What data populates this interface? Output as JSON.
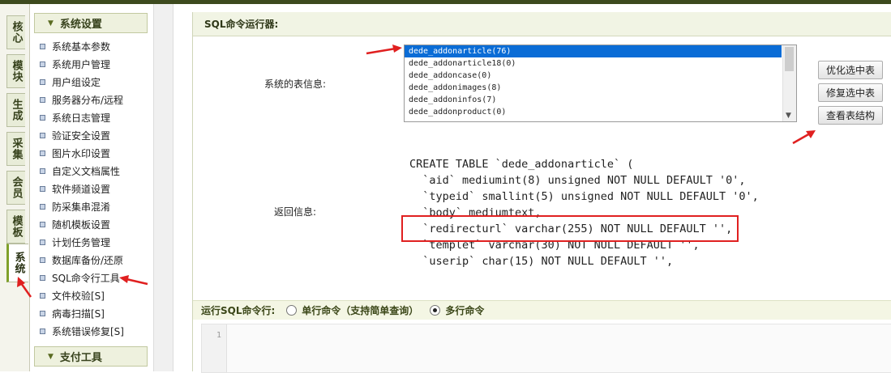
{
  "left_tabs": [
    "核心",
    "模块",
    "生成",
    "采集",
    "会员",
    "模板",
    "系统"
  ],
  "sidebar": {
    "section_title": "系统设置",
    "items": [
      "系统基本参数",
      "系统用户管理",
      "用户组设定",
      "服务器分布/远程",
      "系统日志管理",
      "验证安全设置",
      "图片水印设置",
      "自定义文档属性",
      "软件频道设置",
      "防采集串混淆",
      "随机模板设置",
      "计划任务管理",
      "数据库备份/还原",
      "SQL命令行工具",
      "文件校验[S]",
      "病毒扫描[S]",
      "系统错误修复[S]"
    ],
    "section2_title": "支付工具"
  },
  "panel": {
    "title": "SQL命令运行器:",
    "tables_label": "系统的表信息:",
    "tables": [
      "dede_addonarticle(76)",
      "dede_addonarticle18(0)",
      "dede_addoncase(0)",
      "dede_addonimages(8)",
      "dede_addoninfos(7)",
      "dede_addonproduct(0)"
    ],
    "buttons": {
      "optimize": "优化选中表",
      "repair": "修复选中表",
      "view_structure": "查看表结构"
    },
    "result_label": "返回信息:",
    "result_lines": [
      "CREATE TABLE `dede_addonarticle` (",
      "  `aid` mediumint(8) unsigned NOT NULL DEFAULT '0',",
      "  `typeid` smallint(5) unsigned NOT NULL DEFAULT '0',",
      "  `body` mediumtext,",
      "  `redirecturl` varchar(255) NOT NULL DEFAULT '',",
      "  `templet` varchar(30) NOT NULL DEFAULT '',",
      "  `userip` char(15) NOT NULL DEFAULT '',"
    ],
    "cmd_label": "运行SQL命令行:",
    "radio_single": "单行命令（支持简单查询）",
    "radio_multi": "多行命令",
    "editor_line": "1"
  },
  "colors": {
    "accent_red": "#e02020",
    "header_bg": "#f1f4e4",
    "select_blue": "#0a6cd6"
  }
}
